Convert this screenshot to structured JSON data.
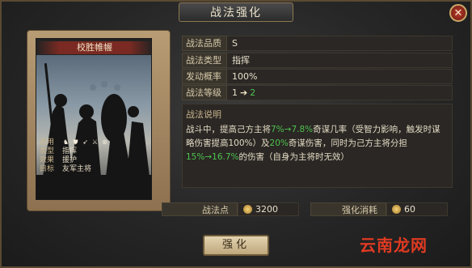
{
  "window": {
    "title": "战法强化"
  },
  "card": {
    "name": "校胜帷幄",
    "info": [
      {
        "key": "适用",
        "value": ""
      },
      {
        "key": "类型",
        "value": "指挥"
      },
      {
        "key": "效果",
        "value": "援护"
      },
      {
        "key": "目标",
        "value": "友军主将"
      }
    ],
    "troop_icons": [
      "cavalry-icon",
      "shield-icon",
      "archer-icon",
      "spear-icon",
      "siege-icon"
    ]
  },
  "attributes": [
    {
      "label": "战法品质",
      "value": "S"
    },
    {
      "label": "战法类型",
      "value": "指挥"
    },
    {
      "label": "发动概率",
      "value": "100%"
    },
    {
      "label": "战法等级",
      "from": "1",
      "to": "2"
    }
  ],
  "description": {
    "title": "战法说明",
    "seg1": "战斗中，提高己方主将",
    "g1a": "7%",
    "arrow1": "→",
    "g1b": "7.8%",
    "seg2": "奇谋几率（受智力影响，触发时谋略伤害提高100%）及",
    "g2": "20%",
    "seg3": "奇谋伤害，同时为己方主将分担",
    "g3a": "15%",
    "arrow2": "→",
    "g3b": "16.7%",
    "seg4": "的伤害（自身为主将时无效）"
  },
  "costs": {
    "points_label": "战法点",
    "points_value": "3200",
    "cost_label": "强化消耗",
    "cost_value": "60"
  },
  "buttons": {
    "strengthen": "强化"
  },
  "watermark": "云南龙网"
}
